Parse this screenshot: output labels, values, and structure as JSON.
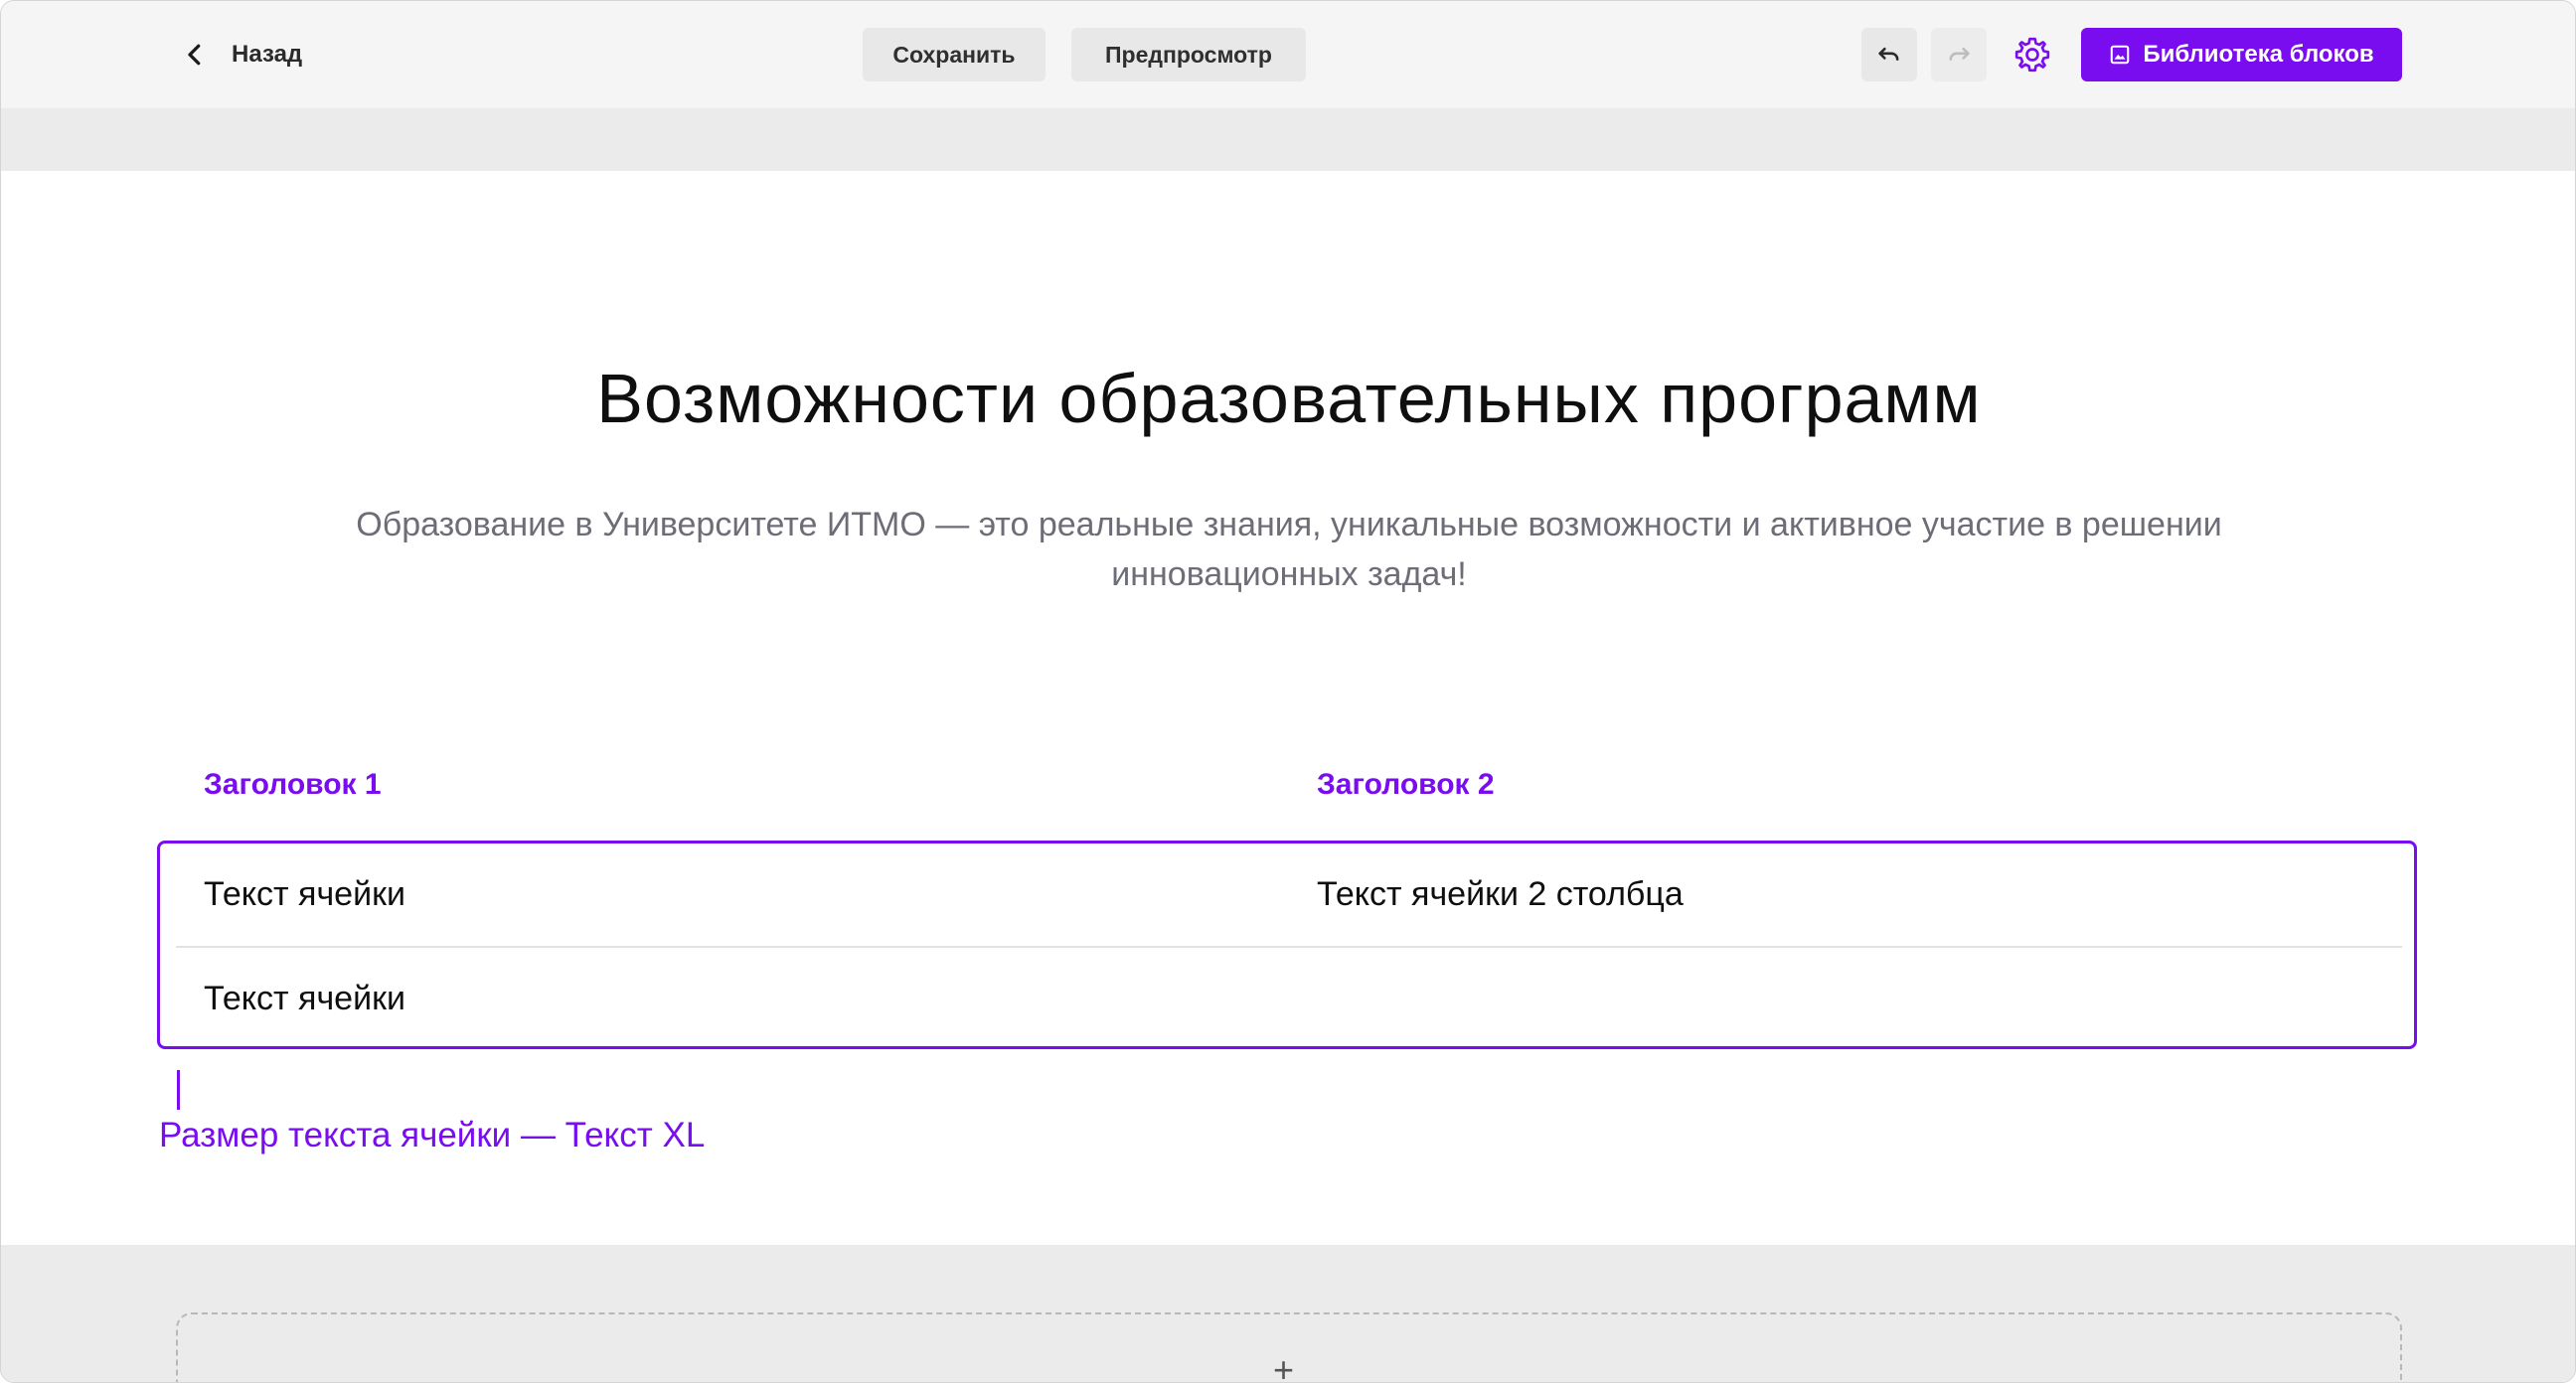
{
  "toolbar": {
    "back_label": "Назад",
    "save_label": "Сохранить",
    "preview_label": "Предпросмотр",
    "library_label": "Библиотека блоков",
    "icons": [
      "chevron-left-icon",
      "undo-icon",
      "redo-icon",
      "gear-icon",
      "image-icon"
    ]
  },
  "content": {
    "title": "Возможности образовательных программ",
    "subtitle": "Образование в Университете ИТМО — это реальные знания, уникальные возможности и активное участие в решении инновационных задач!"
  },
  "table": {
    "headers": [
      "Заголовок 1",
      "Заголовок 2"
    ],
    "rows": [
      [
        "Текст ячейки",
        "Текст ячейки 2 столбца"
      ],
      [
        "Текст ячейки",
        ""
      ]
    ]
  },
  "callout": {
    "text": "Размер текста ячейки — Текст XL"
  },
  "add_block": {
    "symbol": "+"
  },
  "colors": {
    "accent": "#7a0cf0",
    "toolbar_bg": "#f5f5f5",
    "band_bg": "#ebebeb",
    "subtitle_text": "#6d6d78"
  }
}
